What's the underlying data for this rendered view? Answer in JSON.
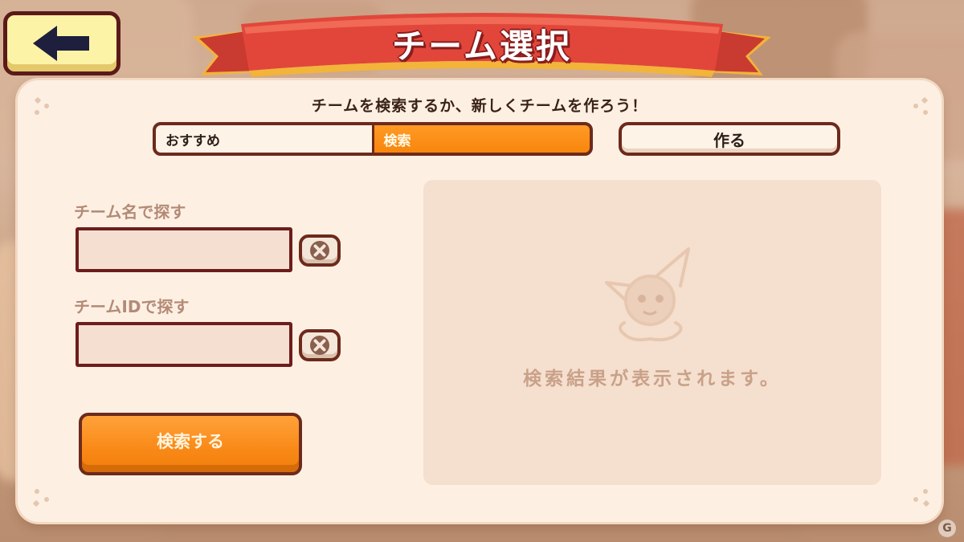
{
  "header": {
    "title": "チーム選択",
    "back_icon": "arrow-left-icon"
  },
  "panel": {
    "instruction": "チームを検索するか、新しくチームを作ろう！"
  },
  "tabs": [
    {
      "label": "おすすめ",
      "active": false
    },
    {
      "label": "検索",
      "active": true
    }
  ],
  "create_button": {
    "label": "作る"
  },
  "search_form": {
    "name_label": "チーム名で探す",
    "name_value": "",
    "id_label": "チームIDで探す",
    "id_value": "",
    "clear_icon": "close-x-icon",
    "submit_label": "検索する"
  },
  "results": {
    "placeholder": "検索結果が表示されます。",
    "mascot_icon": "eevee-icon"
  },
  "watermark": {
    "text": "G"
  },
  "colors": {
    "accent_orange": "#f8860d",
    "outline": "#6d2a1c",
    "panel_bg": "#fdf0e3",
    "ribbon_red": "#e2463a",
    "back_button": "#fdf3a6"
  }
}
